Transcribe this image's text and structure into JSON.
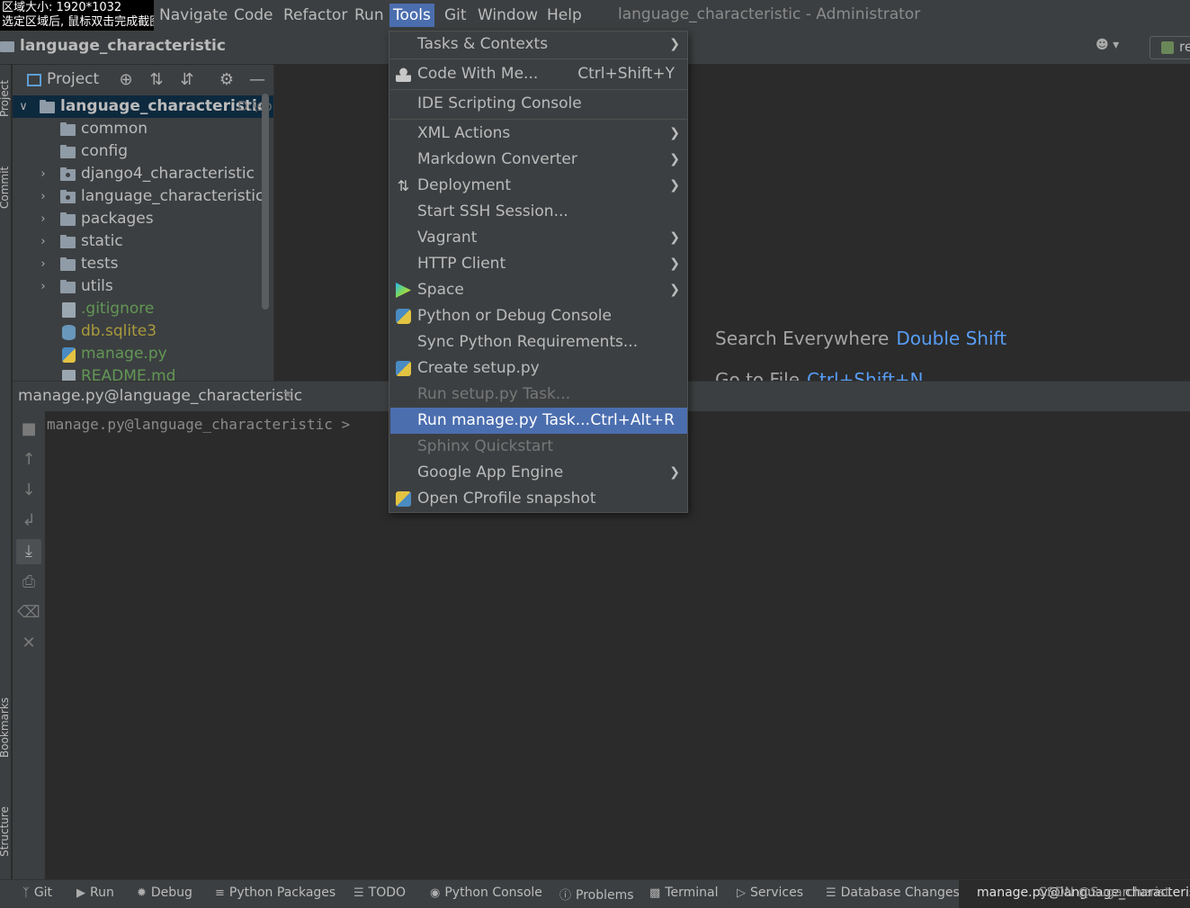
{
  "capture_overlay": {
    "line1": "区域大小: 1920*1032",
    "line2": "选定区域后, 鼠标双击完成截图"
  },
  "menubar": {
    "items": [
      "Navigate",
      "Code",
      "Refactor",
      "Run",
      "Tools",
      "Git",
      "Window",
      "Help"
    ],
    "active": "Tools",
    "window_title": "language_characteristic - Administrator"
  },
  "navbar": {
    "project_name": "language_characteristic",
    "run_config_label": "re"
  },
  "left_strip": {
    "tabs": [
      "Project",
      "Commit",
      "Bookmarks",
      "Structure"
    ]
  },
  "project_panel": {
    "title": "Project",
    "tree": [
      {
        "label": "language_characteristic",
        "suffix": "D:\\so",
        "type": "root"
      },
      {
        "label": "common",
        "type": "folder"
      },
      {
        "label": "config",
        "type": "folder"
      },
      {
        "label": "django4_characteristic",
        "type": "package"
      },
      {
        "label": "language_characteristic",
        "type": "package"
      },
      {
        "label": "packages",
        "type": "folder"
      },
      {
        "label": "static",
        "type": "folder"
      },
      {
        "label": "tests",
        "type": "folder"
      },
      {
        "label": "utils",
        "type": "folder"
      },
      {
        "label": ".gitignore",
        "type": "file"
      },
      {
        "label": "db.sqlite3",
        "type": "db"
      },
      {
        "label": "manage.py",
        "type": "py"
      },
      {
        "label": "README.md",
        "type": "file"
      }
    ]
  },
  "editor": {
    "search_hint": "Search Everywhere",
    "search_key": "Double Shift",
    "goto_hint": "Go to File",
    "goto_key": "Ctrl+Shift+N"
  },
  "run_panel": {
    "tab_title": "manage.py@language_characteristic",
    "prompt": "manage.py@language_characteristic >"
  },
  "tools_menu": {
    "items": [
      {
        "label": "Tasks & Contexts",
        "submenu": true
      },
      {
        "label": "Code With Me...",
        "shortcut": "Ctrl+Shift+Y",
        "icon": "user-icon"
      },
      {
        "label": "IDE Scripting Console"
      },
      {
        "label": "XML Actions",
        "submenu": true
      },
      {
        "label": "Markdown Converter",
        "submenu": true
      },
      {
        "label": "Deployment",
        "submenu": true,
        "icon": "deploy-icon"
      },
      {
        "label": "Start SSH Session..."
      },
      {
        "label": "Vagrant",
        "submenu": true
      },
      {
        "label": "HTTP Client",
        "submenu": true
      },
      {
        "label": "Space",
        "submenu": true,
        "icon": "space-icon"
      },
      {
        "label": "Python or Debug Console",
        "icon": "python-icon"
      },
      {
        "label": "Sync Python Requirements..."
      },
      {
        "label": "Create setup.py",
        "icon": "setup-icon"
      },
      {
        "label": "Run setup.py Task...",
        "disabled": true
      },
      {
        "label": "Run manage.py Task...",
        "shortcut": "Ctrl+Alt+R",
        "highlighted": true
      },
      {
        "label": "Sphinx Quickstart",
        "disabled": true
      },
      {
        "label": "Google App Engine",
        "submenu": true
      },
      {
        "label": "Open CProfile snapshot",
        "icon": "cprofile-icon"
      }
    ]
  },
  "statusbar": {
    "items": [
      "Git",
      "Run",
      "Debug",
      "Python Packages",
      "TODO",
      "Python Console",
      "Problems",
      "Terminal",
      "Services",
      "Database Changes"
    ],
    "right_text": "manage.py@language_characteristic",
    "watermark": "CSDN @Sugarcherist"
  },
  "colors": {
    "accent": "#4b6eaf",
    "background": "#2b2b2b",
    "panel": "#3c3f41",
    "link": "#589df6"
  }
}
